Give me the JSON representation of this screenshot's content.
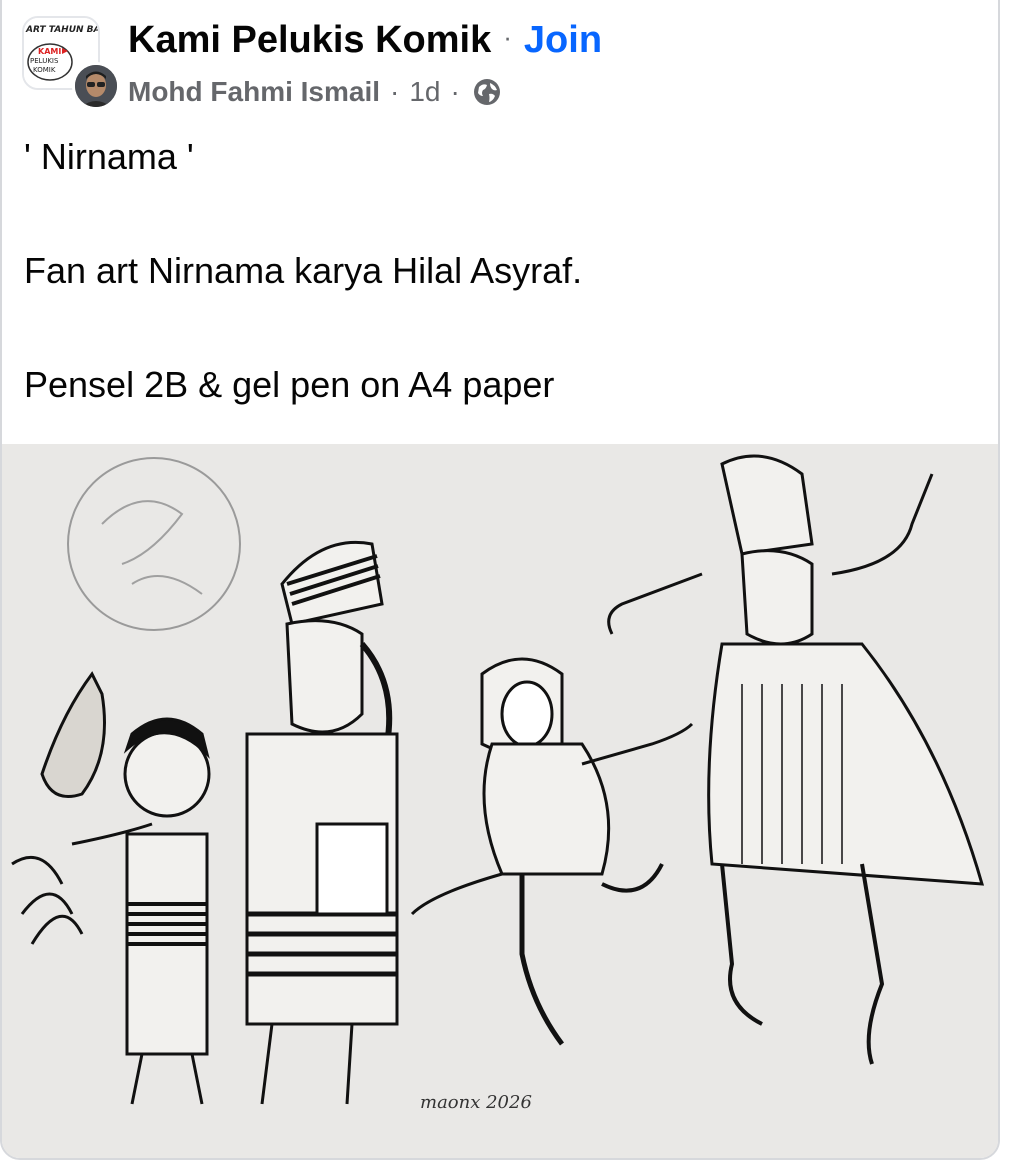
{
  "post": {
    "group_name": "Kami Pelukis Komik",
    "separator": "·",
    "join_label": "Join",
    "author": "Mohd Fahmi Ismail",
    "time": "1d",
    "privacy_icon": "globe-icon",
    "group_logo_text": {
      "top": "ART TAHUN BA",
      "brand": "KAMI",
      "line2": "PELUKIS",
      "line3": "KOMIK"
    },
    "text_lines": [
      "' Nirnama '",
      "Fan art Nirnama karya Hilal Asyraf.",
      "Pensel 2B & gel pen on A4 paper"
    ]
  },
  "photo": {
    "artwork_signature": "maonx 2026"
  },
  "colors": {
    "join": "#0866ff",
    "meta": "#65676b",
    "text": "#050505",
    "paper": "#e9e8e6"
  }
}
